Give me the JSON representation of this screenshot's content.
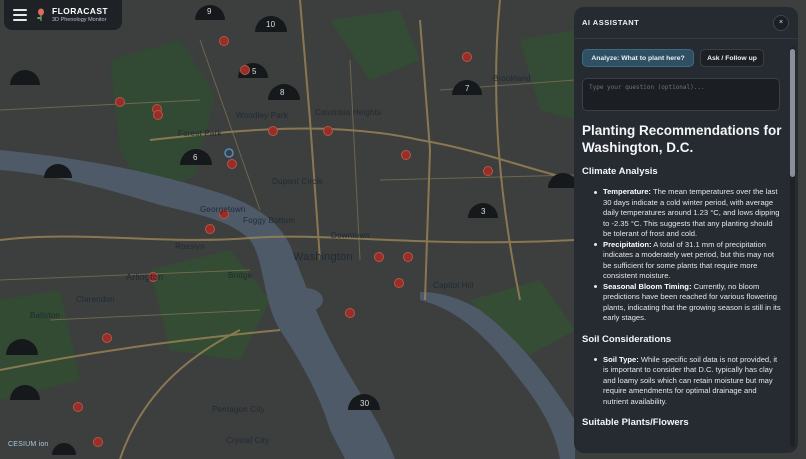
{
  "app": {
    "title": "FLORACAST",
    "subtitle": "3D Phenology Monitor"
  },
  "map": {
    "labels": {
      "forest_park": "Forest Park",
      "woodley_park": "Woodley Park",
      "columbia_heights": "Columbia Heights",
      "brookland": "Brookland",
      "dupont_circle": "Dupont Circle",
      "georgetown": "Georgetown",
      "foggy_bottom": "Foggy Bottom",
      "rosslyn": "Rosslyn",
      "downtown": "Downtown",
      "washington": "Washington",
      "arlington": "Arlington",
      "clarendon": "Clarendon",
      "ballston": "Ballston",
      "capitol_hill": "Capitol Hill",
      "pentagon_city": "Pentagon City",
      "crystal_city": "Crystal City",
      "bridge": "Bridge"
    },
    "marker_numbers": {
      "m1": "9",
      "m2": "5",
      "m3": "6",
      "m4": "7",
      "m5": "8",
      "m6": "3",
      "m7": "30",
      "m8": "10"
    },
    "attribution": "CESIUM ion"
  },
  "ai": {
    "title": "AI ASSISTANT",
    "close_label": "×",
    "analyze_label": "Analyze: What to plant here?",
    "ask_label": "Ask / Follow up",
    "question_placeholder": "Type your question (optional)...",
    "heading": "Planting Recommendations for Washington, D.C.",
    "sections": {
      "climate": {
        "title": "Climate Analysis",
        "items": [
          {
            "label": "Temperature:",
            "text": " The mean temperatures over the last 30 days indicate a cold winter period, with average daily temperatures around 1.23 °C, and lows dipping to -2.35 °C. This suggests that any planting should be tolerant of frost and cold."
          },
          {
            "label": "Precipitation:",
            "text": " A total of 31.1 mm of precipitation indicates a moderately wet period, but this may not be sufficient for some plants that require more consistent moisture."
          },
          {
            "label": "Seasonal Bloom Timing:",
            "text": " Currently, no bloom predictions have been reached for various flowering plants, indicating that the growing season is still in its early stages."
          }
        ]
      },
      "soil": {
        "title": "Soil Considerations",
        "items": [
          {
            "label": "Soil Type:",
            "text": " While specific soil data is not provided, it is important to consider that D.C. typically has clay and loamy soils which can retain moisture but may require amendments for optimal drainage and nutrient availability."
          }
        ]
      },
      "plants": {
        "title": "Suitable Plants/Flowers"
      }
    }
  }
}
